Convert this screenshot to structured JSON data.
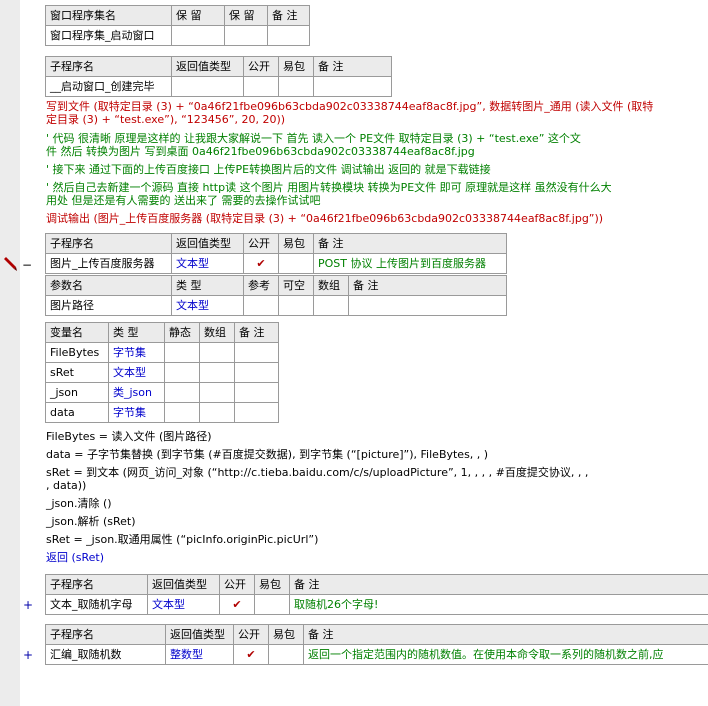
{
  "window_table": {
    "headers": [
      "窗口程序集名",
      "保 留",
      "保 留",
      "备 注"
    ],
    "row": [
      "窗口程序集_启动窗口",
      "",
      "",
      ""
    ]
  },
  "sub1": {
    "headers": [
      "子程序名",
      "返回值类型",
      "公开",
      "易包",
      "备 注"
    ],
    "row": [
      "__启动窗口_创建完毕",
      "",
      "",
      "",
      ""
    ]
  },
  "code1": {
    "l1a": "写到文件 (取特定目录 (3) + “0a46f21fbe096b63cbda902c03338744eaf8ac8f.jpg”, 数据转图片_通用 (读入文件 (取特",
    "l1b": "定目录 (3) + “test.exe”), “123456”, 20, 20))",
    "c1a": "' 代码 很清晰  原理是这样的 让我跟大家解说一下   首先 读入一个 PE文件 取特定目录 (3) + “test.exe”  这个文",
    "c1b": "件  然后 转换为图片 写到桌面 0a46f21fbe096b63cbda902c03338744eaf8ac8f.jpg",
    "c2": "' 接下来 通过下面的上传百度接口  上传PE转换图片后的文件 调试输出 返回的 就是下载链接",
    "c3a": "' 然后自己去新建一个源码  直接 http读 这个图片 用图片转换模块 转换为PE文件 即可  原理就是这样  虽然没有什么大",
    "c3b": "用处  但是还是有人需要的 送出来了  需要的去操作试试吧",
    "l2": "调试输出 (图片_上传百度服务器 (取特定目录 (3) + “0a46f21fbe096b63cbda902c03338744eaf8ac8f.jpg”))"
  },
  "sub2": {
    "headers": [
      "子程序名",
      "返回值类型",
      "公开",
      "易包",
      "备 注"
    ],
    "row": [
      "图片_上传百度服务器",
      "文本型",
      "✔",
      "",
      "POST 协议 上传图片到百度服务器"
    ],
    "param_headers": [
      "参数名",
      "类 型",
      "参考",
      "可空",
      "数组",
      "备 注"
    ],
    "param_row": [
      "图片路径",
      "文本型",
      "",
      "",
      "",
      ""
    ]
  },
  "vars": {
    "headers": [
      "变量名",
      "类 型",
      "静态",
      "数组",
      "备 注"
    ],
    "rows": [
      [
        "FileBytes",
        "字节集",
        "",
        "",
        ""
      ],
      [
        "sRet",
        "文本型",
        "",
        "",
        ""
      ],
      [
        "_json",
        "类_json",
        "",
        "",
        ""
      ],
      [
        "data",
        "字节集",
        "",
        "",
        ""
      ]
    ]
  },
  "code2": {
    "l1": "FileBytes = 读入文件 (图片路径)",
    "l2": "data = 子字节集替换 (到字节集 (#百度提交数据), 到字节集 (“[picture]”), FileBytes, , )",
    "l3a": "sRet = 到文本 (网页_访问_对象 (“http://c.tieba.baidu.com/c/s/uploadPicture”, 1, , , , #百度提交协议, , ,",
    "l3b": " , data))",
    "l4": "_json.清除 ()",
    "l5": "_json.解析 (sRet)",
    "l6": "sRet = _json.取通用属性 (“picInfo.originPic.picUrl”)",
    "l7": "返回 (sRet)"
  },
  "sub3": {
    "headers": [
      "子程序名",
      "返回值类型",
      "公开",
      "易包",
      "备 注"
    ],
    "row": [
      "文本_取随机字母",
      "文本型",
      "✔",
      "",
      "取随机26个字母!"
    ]
  },
  "sub4": {
    "headers": [
      "子程序名",
      "返回值类型",
      "公开",
      "易包",
      "备 注"
    ],
    "row": [
      "汇编_取随机数",
      "整数型",
      "✔",
      "",
      "返回一个指定范围内的随机数值。在使用本命令取一系列的随机数之前,应"
    ]
  },
  "markers": {
    "plus": "+",
    "minus": "−"
  }
}
